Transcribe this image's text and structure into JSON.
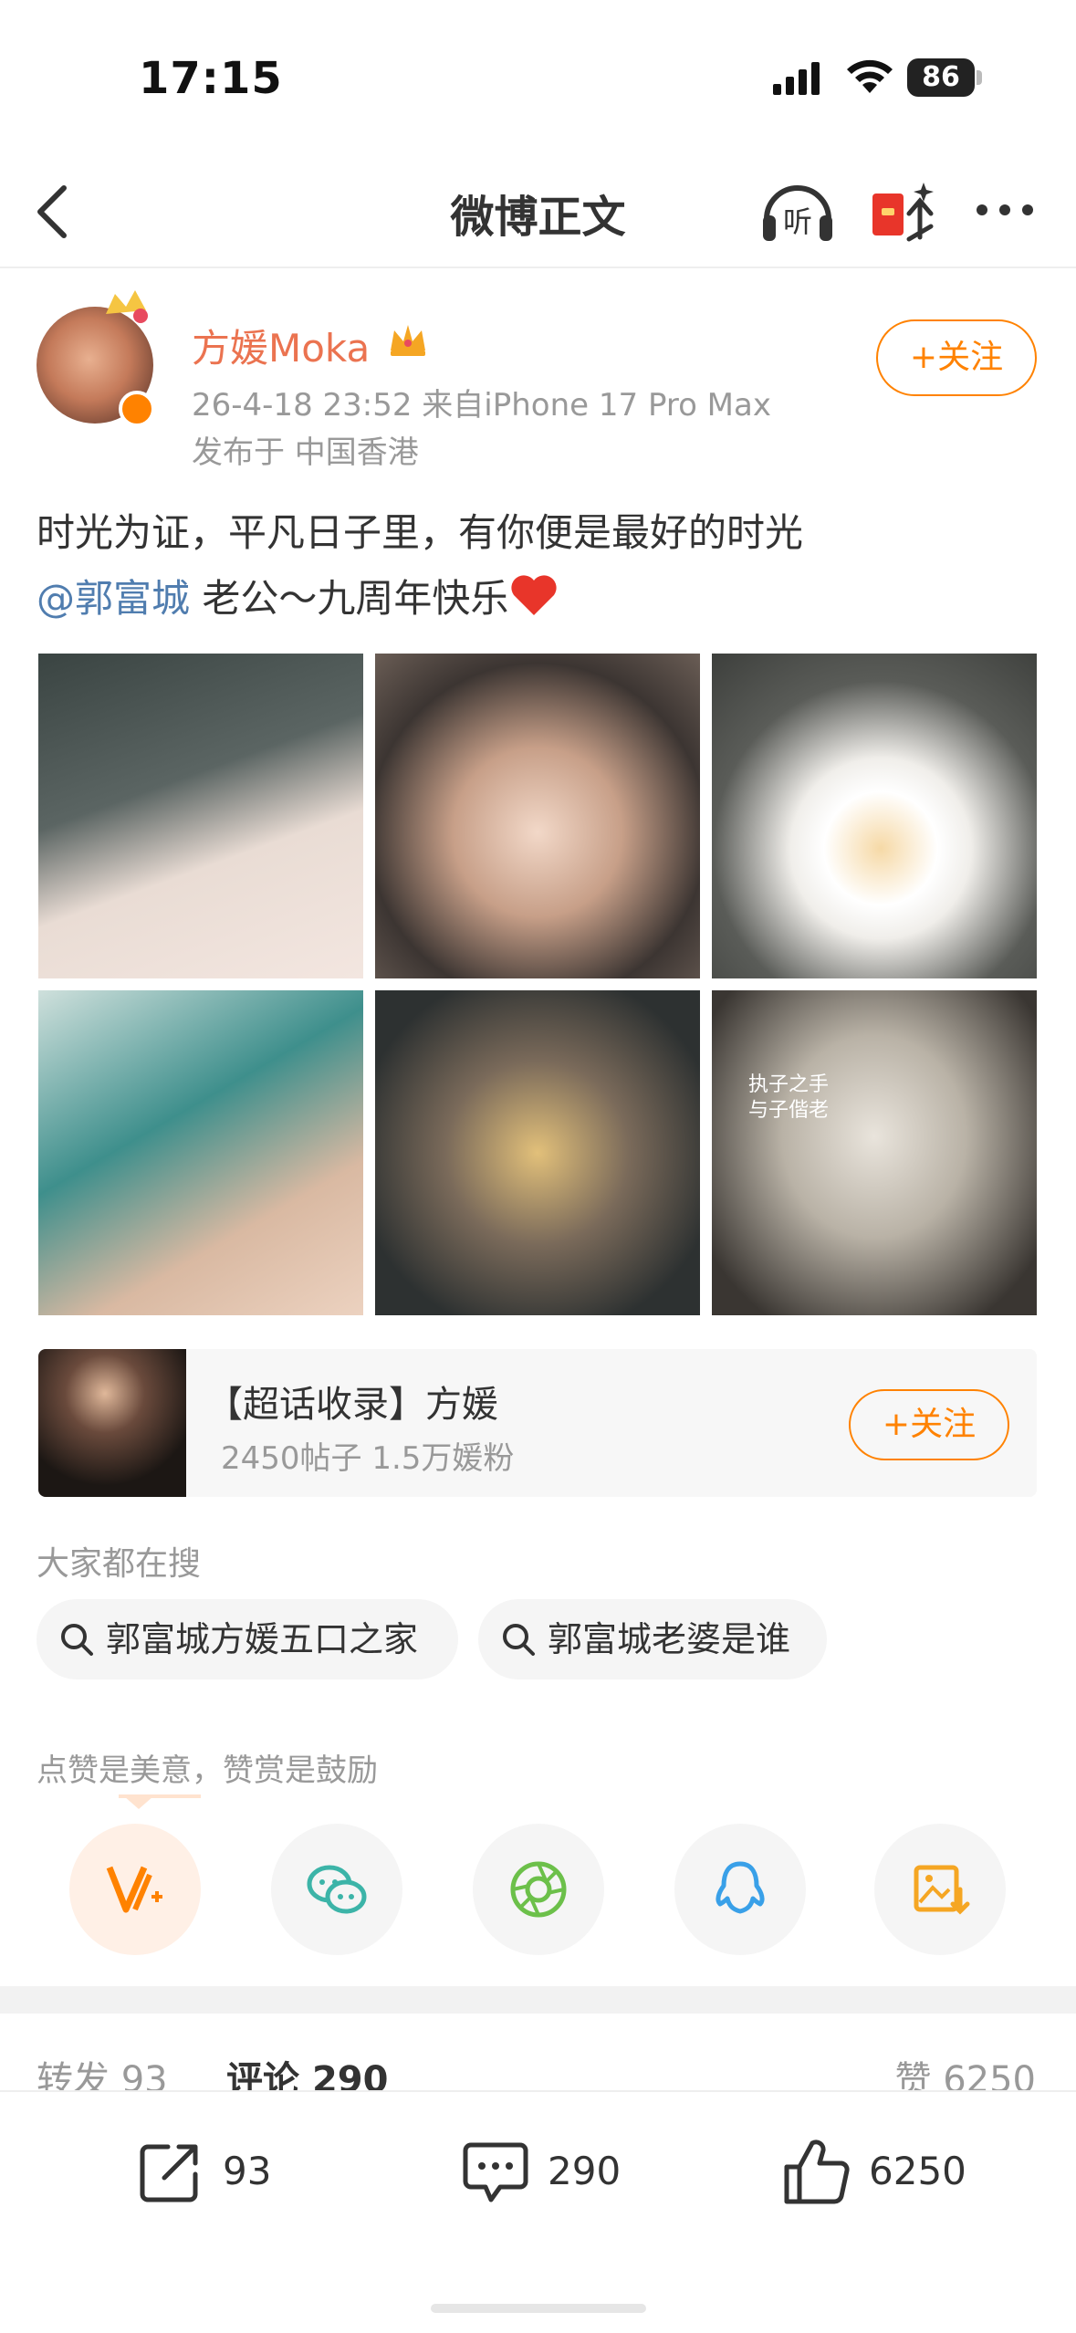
{
  "status_bar": {
    "time": "17:15",
    "battery": "86"
  },
  "nav": {
    "title": "微博正文",
    "listen_label": "听"
  },
  "author": {
    "name": "方媛Moka",
    "meta": "26-4-18 23:52  来自iPhone 17 Pro Max",
    "location": "发布于 中国香港",
    "follow_label": "+关注"
  },
  "post": {
    "line1": "时光为证，平凡日子里，有你便是最好的时光",
    "mention": "@郭富城",
    "line2_rest": " 老公～九周年快乐",
    "photo6_caption_1": "执子之手",
    "photo6_caption_2": "与子偕老"
  },
  "topic": {
    "title": "【超话收录】方媛",
    "stats": "2450帖子 1.5万媛粉",
    "follow_label": "+关注"
  },
  "search": {
    "heading": "大家都在搜",
    "chips": [
      "郭富城方媛五口之家",
      "郭富城老婆是谁"
    ]
  },
  "share": {
    "heading": "点赞是美意，赞赏是鼓励"
  },
  "tabs": {
    "repost_label": "转发",
    "repost_count": "93",
    "comments_label": "评论",
    "comments_count": "290",
    "likes_label": "赞",
    "likes_count": "6250"
  },
  "actions": {
    "repost": "93",
    "comment": "290",
    "like": "6250"
  },
  "colors": {
    "accent": "#ff8200",
    "name": "#eb7350",
    "mention": "#507daf"
  }
}
